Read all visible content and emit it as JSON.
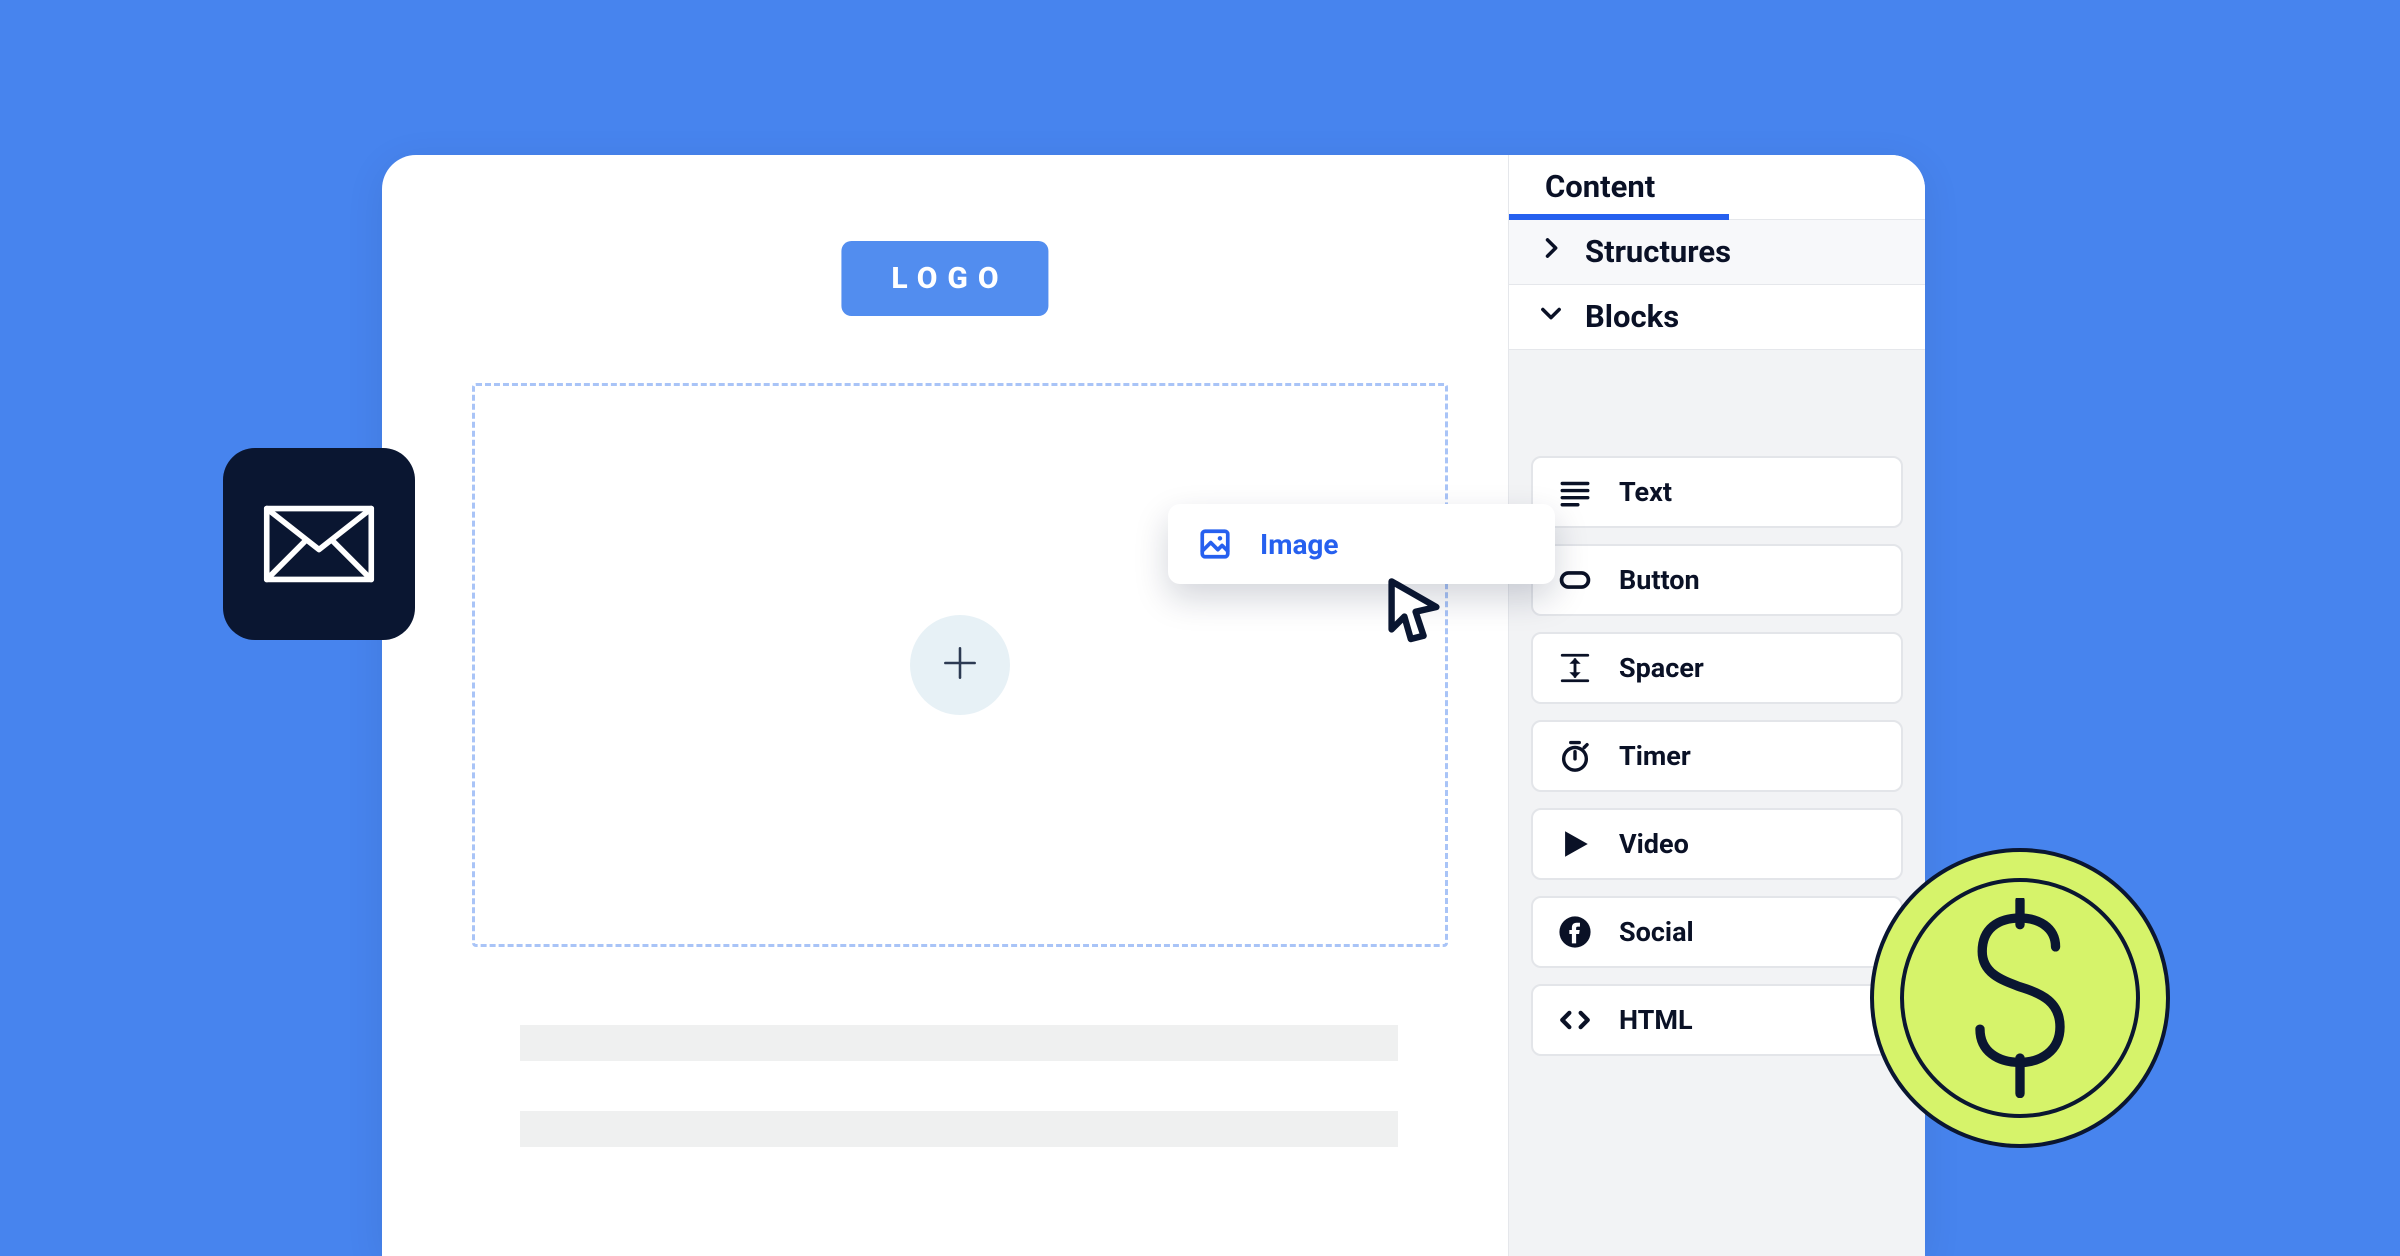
{
  "canvas": {
    "logo_label": "LOGO"
  },
  "sidebar": {
    "tab_label": "Content",
    "sections": {
      "structures_label": "Structures",
      "blocks_label": "Blocks"
    },
    "blocks": [
      {
        "label": "Text"
      },
      {
        "label": "Button"
      },
      {
        "label": "Spacer"
      },
      {
        "label": "Timer"
      },
      {
        "label": "Video"
      },
      {
        "label": "Social"
      },
      {
        "label": "HTML"
      }
    ]
  },
  "drag": {
    "label": "Image"
  }
}
